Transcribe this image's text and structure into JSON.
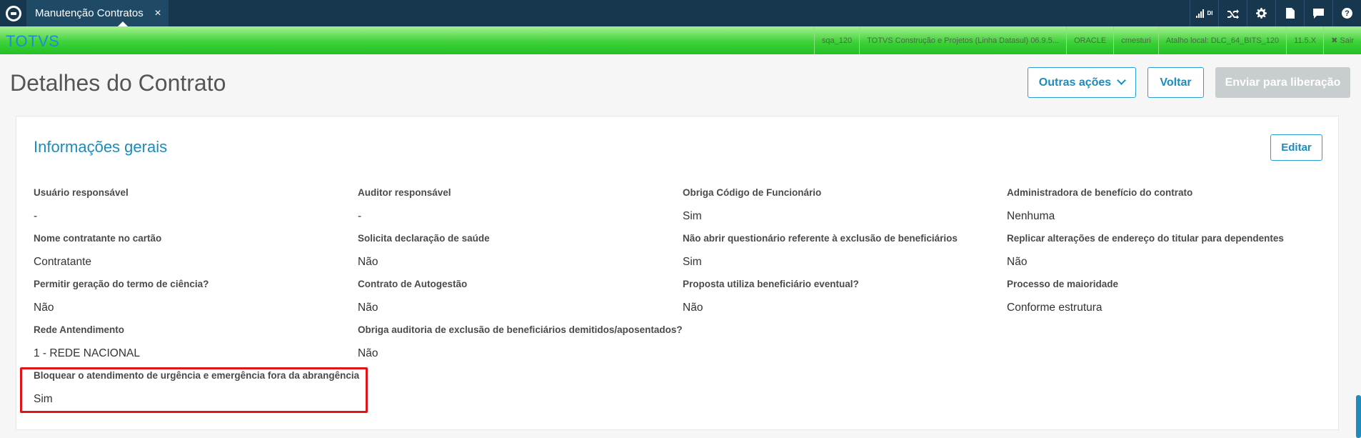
{
  "topbar": {
    "tab_label": "Manutenção Contratos",
    "tab_close": "×",
    "icons": [
      "signal-icon",
      "shuffle-icon",
      "gear-icon",
      "document-icon",
      "chat-icon",
      "help-icon"
    ],
    "signal_text": "DI",
    "help_text": "?"
  },
  "greenbar": {
    "brand": "TOTVS",
    "env": [
      "sqa_120",
      "TOTVS Construção e Projetos (Linha Datasul) 06.9.5...",
      "ORACLE",
      "cmesturi",
      "Atalho local: DLC_64_BITS_120",
      "11.5.X"
    ],
    "exit_label": "✖ Sair"
  },
  "header": {
    "title": "Detalhes do Contrato",
    "outras_acoes": "Outras ações",
    "voltar": "Voltar",
    "enviar": "Enviar para liberação"
  },
  "card": {
    "title": "Informações gerais",
    "edit_label": "Editar",
    "fields": [
      {
        "label": "Usuário responsável",
        "value": "-"
      },
      {
        "label": "Auditor responsável",
        "value": "-"
      },
      {
        "label": "Obriga Código de Funcionário",
        "value": "Sim"
      },
      {
        "label": "Administradora de benefício do contrato",
        "value": "Nenhuma"
      },
      {
        "label": "Nome contratante no cartão",
        "value": "Contratante"
      },
      {
        "label": "Solicita declaração de saúde",
        "value": "Não"
      },
      {
        "label": "Não abrir questionário referente à exclusão de beneficiários",
        "value": "Sim"
      },
      {
        "label": "Replicar alterações de endereço do titular para dependentes",
        "value": "Não"
      },
      {
        "label": "Permitir geração do termo de ciência?",
        "value": "Não"
      },
      {
        "label": "Contrato de Autogestão",
        "value": "Não"
      },
      {
        "label": "Proposta utiliza beneficiário eventual?",
        "value": "Não"
      },
      {
        "label": "Processo de maioridade",
        "value": "Conforme estrutura"
      },
      {
        "label": "Rede Antendimento",
        "value": "1 - REDE NACIONAL"
      },
      {
        "label": "Obriga auditoria de exclusão de beneficiários demitidos/aposentados?",
        "value": "Não"
      },
      {
        "label": "Bloquear o atendimento de urgência e emergência fora da abrangência",
        "value": "Sim"
      }
    ]
  },
  "colors": {
    "topbar": "#17374f",
    "accent": "#1d8bbb",
    "highlight": "#e3131a",
    "green": "#3fd23a"
  }
}
